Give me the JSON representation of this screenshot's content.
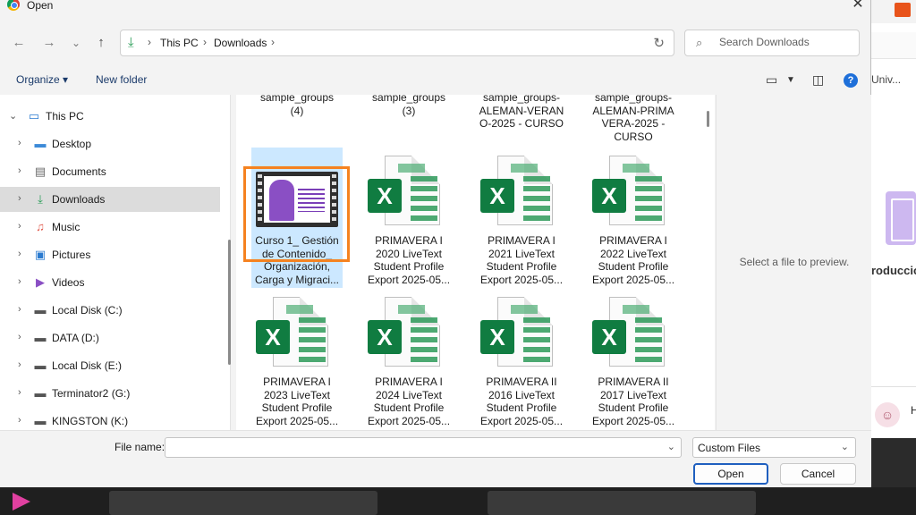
{
  "window": {
    "title": "Open",
    "close_glyph": "✕"
  },
  "nav": {
    "back": "←",
    "forward": "→",
    "recent": "⌄",
    "up": "↑"
  },
  "address": {
    "crumbs": [
      "This PC",
      "Downloads"
    ],
    "sep": "›"
  },
  "search": {
    "placeholder": "Search Downloads"
  },
  "toolbar": {
    "organize": "Organize ▾",
    "new_folder": "New folder",
    "help": "?"
  },
  "sidebar": {
    "items": [
      {
        "label": "This PC",
        "icon": "pc-icon"
      },
      {
        "label": "Desktop",
        "icon": "desktop-icon"
      },
      {
        "label": "Documents",
        "icon": "documents-icon"
      },
      {
        "label": "Downloads",
        "icon": "download-icon"
      },
      {
        "label": "Music",
        "icon": "music-icon"
      },
      {
        "label": "Pictures",
        "icon": "pictures-icon"
      },
      {
        "label": "Videos",
        "icon": "videos-icon"
      },
      {
        "label": "Local Disk (C:)",
        "icon": "drive-icon"
      },
      {
        "label": "DATA (D:)",
        "icon": "drive-icon"
      },
      {
        "label": "Local Disk (E:)",
        "icon": "drive-icon"
      },
      {
        "label": "Terminator2 (G:)",
        "icon": "drive-icon"
      },
      {
        "label": "KINGSTON (K:)",
        "icon": "drive-icon"
      }
    ]
  },
  "files": {
    "row0": [
      {
        "name": "sample_groups\n(4)"
      },
      {
        "name": "sample_groups\n(3)"
      },
      {
        "name": "sample_groups-\nALEMAN-VERAN\nO-2025 - CURSO"
      },
      {
        "name": "sample_groups-\nALEMAN-PRIMA\nVERA-2025 -\nCURSO"
      }
    ],
    "row1": [
      {
        "name": "Curso 1_ Gestión\nde Contenido_\nOrganización,\nCarga y Migraci...",
        "type": "video"
      },
      {
        "name": "PRIMAVERA I\n2020 LiveText\nStudent Profile\nExport 2025-05...",
        "type": "excel"
      },
      {
        "name": "PRIMAVERA I\n2021 LiveText\nStudent Profile\nExport 2025-05...",
        "type": "excel"
      },
      {
        "name": "PRIMAVERA I\n2022 LiveText\nStudent Profile\nExport 2025-05...",
        "type": "excel"
      }
    ],
    "row2": [
      {
        "name": "PRIMAVERA I\n2023 LiveText\nStudent Profile\nExport 2025-05...",
        "type": "excel"
      },
      {
        "name": "PRIMAVERA I\n2024 LiveText\nStudent Profile\nExport 2025-05...",
        "type": "excel"
      },
      {
        "name": "PRIMAVERA II\n2016 LiveText\nStudent Profile\nExport 2025-05...",
        "type": "excel"
      },
      {
        "name": "PRIMAVERA II\n2017 LiveText\nStudent Profile\nExport 2025-05...",
        "type": "excel"
      }
    ]
  },
  "preview": {
    "text": "Select a file to preview."
  },
  "bottom": {
    "file_name_label": "File name:",
    "file_name_value": "",
    "filter": "Custom Files",
    "open": "Open",
    "cancel": "Cancel"
  },
  "background_app": {
    "univ": "Univ...",
    "prod": "roducció",
    "h": "H"
  },
  "colors": {
    "accent": "#1f5fbf",
    "excel": "#107c41",
    "highlight": "#f58220",
    "download": "#2a9d57"
  }
}
